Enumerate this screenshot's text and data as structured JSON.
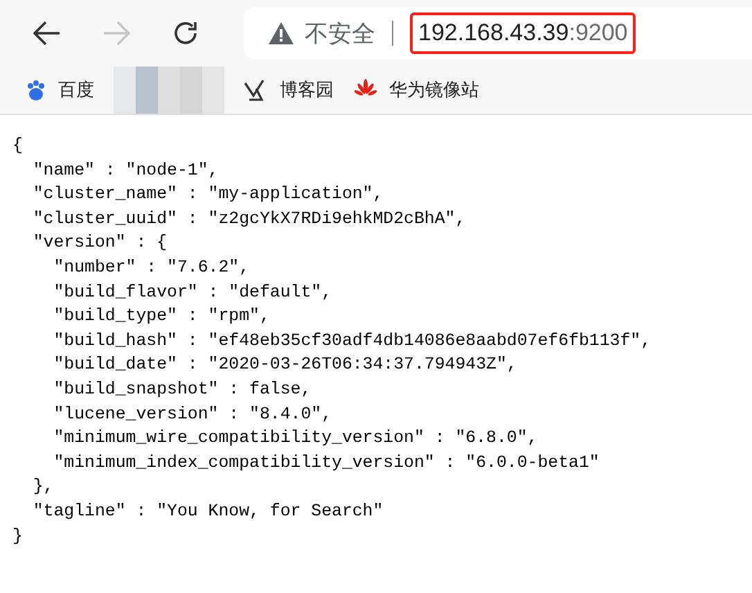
{
  "toolbar": {
    "back_enabled": true,
    "forward_enabled": false,
    "security_label": "不安全",
    "url_host": "192.168.43.39",
    "url_port": ":9200",
    "url_highlighted": true
  },
  "bookmarks": [
    {
      "kind": "paw",
      "label": "百度"
    },
    {
      "kind": "hidden"
    },
    {
      "kind": "blog",
      "label": "博客园"
    },
    {
      "kind": "flower",
      "label": "华为镜像站"
    }
  ],
  "body_lines": [
    "{",
    "  \"name\" : \"node-1\",",
    "  \"cluster_name\" : \"my-application\",",
    "  \"cluster_uuid\" : \"z2gcYkX7RDi9ehkMD2cBhA\",",
    "  \"version\" : {",
    "    \"number\" : \"7.6.2\",",
    "    \"build_flavor\" : \"default\",",
    "    \"build_type\" : \"rpm\",",
    "    \"build_hash\" : \"ef48eb35cf30adf4db14086e8aabd07ef6fb113f\",",
    "    \"build_date\" : \"2020-03-26T06:34:37.794943Z\",",
    "    \"build_snapshot\" : false,",
    "    \"lucene_version\" : \"8.4.0\",",
    "    \"minimum_wire_compatibility_version\" : \"6.8.0\",",
    "    \"minimum_index_compatibility_version\" : \"6.0.0-beta1\"",
    "  },",
    "  \"tagline\" : \"You Know, for Search\"",
    "}"
  ]
}
